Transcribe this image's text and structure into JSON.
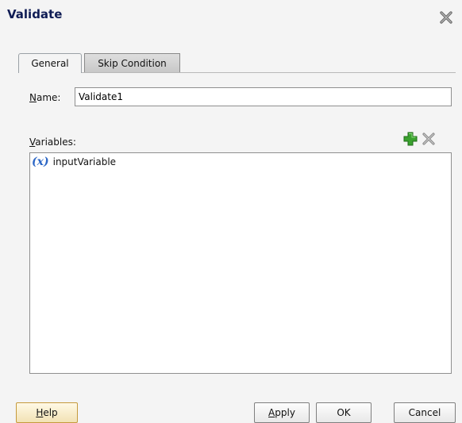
{
  "dialog": {
    "title": "Validate"
  },
  "tabs": [
    {
      "label": "General",
      "active": true
    },
    {
      "label": "Skip Condition",
      "active": false
    }
  ],
  "form": {
    "name_label_first": "N",
    "name_label_rest": "ame:",
    "name_value": "Validate1",
    "variables_label_first": "V",
    "variables_label_rest": "ariables:"
  },
  "variables": [
    {
      "icon_text": "(x)",
      "label": "inputVariable"
    }
  ],
  "buttons": {
    "help_first": "H",
    "help_rest": "elp",
    "apply_first": "A",
    "apply_rest": "pply",
    "ok": "OK",
    "cancel": "Cancel"
  },
  "icons": {
    "close": "close-x-icon",
    "add": "green-plus-icon",
    "remove": "grey-x-icon",
    "variable": "variable-x-icon"
  },
  "colors": {
    "title": "#101d55",
    "add_icon": "#3aa12e",
    "variable_icon": "#2d67c6",
    "help_button_border": "#c59a3c"
  }
}
